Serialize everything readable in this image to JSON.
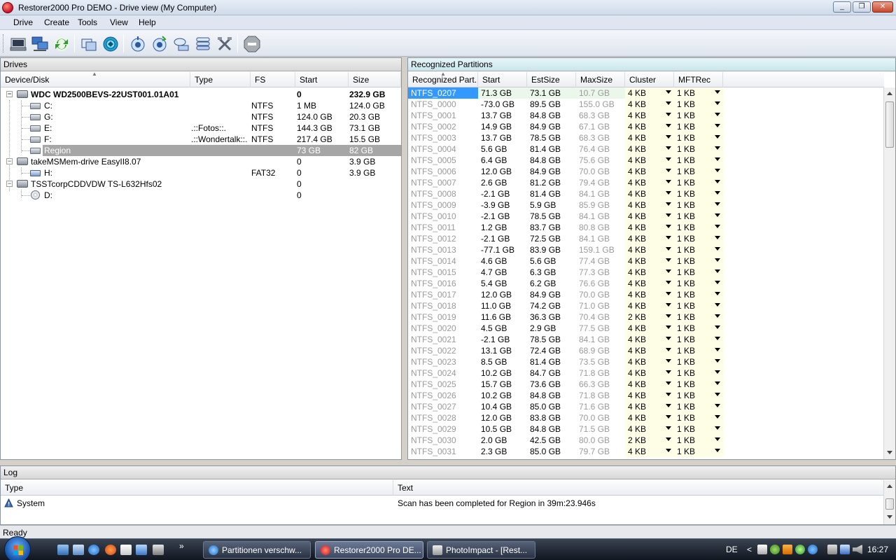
{
  "window": {
    "title": "Restorer2000 Pro DEMO - Drive view (My Computer)",
    "minimize_glyph": "_",
    "maximize_glyph": "❐",
    "close_glyph": "✕"
  },
  "menu": [
    "Drive",
    "Create",
    "Tools",
    "View",
    "Help"
  ],
  "toolbar": {
    "icons": [
      "drive-icon",
      "network-drive-icon",
      "refresh-icon",
      "copy-icon",
      "globe-icon",
      "scan-icon",
      "search-icon",
      "network-icon",
      "stack-icon",
      "tools-icon",
      "stop-icon"
    ]
  },
  "drives": {
    "panel_title": "Drives",
    "columns": [
      "Device/Disk",
      "Type",
      "FS",
      "Start",
      "Size"
    ],
    "rows": [
      {
        "name": "WDC WD2500BEVS-22UST001.01A01",
        "type": "",
        "fs": "",
        "start": "0",
        "size": "232.9 GB",
        "icon": "disk-icon"
      },
      {
        "name": "C:",
        "type": "",
        "fs": "NTFS",
        "start": "1 MB",
        "size": "124.0 GB",
        "icon": "drive-icon"
      },
      {
        "name": "G:",
        "type": "",
        "fs": "NTFS",
        "start": "124.0 GB",
        "size": "20.3 GB",
        "icon": "drive-icon"
      },
      {
        "name": "E:",
        "type": ".::Fotos::.",
        "fs": "NTFS",
        "start": "144.3 GB",
        "size": "73.1 GB",
        "icon": "drive-icon"
      },
      {
        "name": "F:",
        "type": ".::Wondertalk::.",
        "fs": "NTFS",
        "start": "217.4 GB",
        "size": "15.5 GB",
        "icon": "drive-icon"
      },
      {
        "name": "Region",
        "type": "",
        "fs": "",
        "start": "73 GB",
        "size": "82 GB",
        "icon": "drive-icon"
      },
      {
        "name": "takeMSMem-drive EasyII8.07",
        "type": "",
        "fs": "",
        "start": "0",
        "size": "3.9 GB",
        "icon": "disk-icon"
      },
      {
        "name": "H:",
        "type": "",
        "fs": "FAT32",
        "start": "0",
        "size": "3.9 GB",
        "icon": "usb-icon"
      },
      {
        "name": "TSSTcorpCDDVDW TS-L632Hfs02",
        "type": "",
        "fs": "",
        "start": "0",
        "size": "",
        "icon": "disk-icon"
      },
      {
        "name": "D:",
        "type": "",
        "fs": "",
        "start": "0",
        "size": "",
        "icon": "cd-icon"
      }
    ]
  },
  "partitions": {
    "panel_title": "Recognized Partitions",
    "columns": [
      "Recognized Part...",
      "Start",
      "EstSize",
      "MaxSize",
      "Cluster",
      "MFTRec"
    ],
    "rows": [
      [
        "NTFS_0207",
        "71.3 GB",
        "73.1 GB",
        "10.7 GB",
        "4 KB",
        "1 KB"
      ],
      [
        "NTFS_0000",
        "-73.0 GB",
        "89.5 GB",
        "155.0 GB",
        "4 KB",
        "1 KB"
      ],
      [
        "NTFS_0001",
        "13.7 GB",
        "84.8 GB",
        "68.3 GB",
        "4 KB",
        "1 KB"
      ],
      [
        "NTFS_0002",
        "14.9 GB",
        "84.9 GB",
        "67.1 GB",
        "4 KB",
        "1 KB"
      ],
      [
        "NTFS_0003",
        "13.7 GB",
        "78.5 GB",
        "68.3 GB",
        "4 KB",
        "1 KB"
      ],
      [
        "NTFS_0004",
        "5.6 GB",
        "81.4 GB",
        "76.4 GB",
        "4 KB",
        "1 KB"
      ],
      [
        "NTFS_0005",
        "6.4 GB",
        "84.8 GB",
        "75.6 GB",
        "4 KB",
        "1 KB"
      ],
      [
        "NTFS_0006",
        "12.0 GB",
        "84.9 GB",
        "70.0 GB",
        "4 KB",
        "1 KB"
      ],
      [
        "NTFS_0007",
        "2.6 GB",
        "81.2 GB",
        "79.4 GB",
        "4 KB",
        "1 KB"
      ],
      [
        "NTFS_0008",
        "-2.1 GB",
        "81.4 GB",
        "84.1 GB",
        "4 KB",
        "1 KB"
      ],
      [
        "NTFS_0009",
        "-3.9 GB",
        "5.9 GB",
        "85.9 GB",
        "4 KB",
        "1 KB"
      ],
      [
        "NTFS_0010",
        "-2.1 GB",
        "78.5 GB",
        "84.1 GB",
        "4 KB",
        "1 KB"
      ],
      [
        "NTFS_0011",
        "1.2 GB",
        "83.7 GB",
        "80.8 GB",
        "4 KB",
        "1 KB"
      ],
      [
        "NTFS_0012",
        "-2.1 GB",
        "72.5 GB",
        "84.1 GB",
        "4 KB",
        "1 KB"
      ],
      [
        "NTFS_0013",
        "-77.1 GB",
        "83.9 GB",
        "159.1 GB",
        "4 KB",
        "1 KB"
      ],
      [
        "NTFS_0014",
        "4.6 GB",
        "5.6 GB",
        "77.4 GB",
        "4 KB",
        "1 KB"
      ],
      [
        "NTFS_0015",
        "4.7 GB",
        "6.3 GB",
        "77.3 GB",
        "4 KB",
        "1 KB"
      ],
      [
        "NTFS_0016",
        "5.4 GB",
        "6.2 GB",
        "76.6 GB",
        "4 KB",
        "1 KB"
      ],
      [
        "NTFS_0017",
        "12.0 GB",
        "84.9 GB",
        "70.0 GB",
        "4 KB",
        "1 KB"
      ],
      [
        "NTFS_0018",
        "11.0 GB",
        "74.2 GB",
        "71.0 GB",
        "4 KB",
        "1 KB"
      ],
      [
        "NTFS_0019",
        "11.6 GB",
        "36.3 GB",
        "70.4 GB",
        "2 KB",
        "1 KB"
      ],
      [
        "NTFS_0020",
        "4.5 GB",
        "2.9 GB",
        "77.5 GB",
        "4 KB",
        "1 KB"
      ],
      [
        "NTFS_0021",
        "-2.1 GB",
        "78.5 GB",
        "84.1 GB",
        "4 KB",
        "1 KB"
      ],
      [
        "NTFS_0022",
        "13.1 GB",
        "72.4 GB",
        "68.9 GB",
        "4 KB",
        "1 KB"
      ],
      [
        "NTFS_0023",
        "8.5 GB",
        "81.4 GB",
        "73.5 GB",
        "4 KB",
        "1 KB"
      ],
      [
        "NTFS_0024",
        "10.2 GB",
        "84.7 GB",
        "71.8 GB",
        "4 KB",
        "1 KB"
      ],
      [
        "NTFS_0025",
        "15.7 GB",
        "73.6 GB",
        "66.3 GB",
        "4 KB",
        "1 KB"
      ],
      [
        "NTFS_0026",
        "10.2 GB",
        "84.8 GB",
        "71.8 GB",
        "4 KB",
        "1 KB"
      ],
      [
        "NTFS_0027",
        "10.4 GB",
        "85.0 GB",
        "71.6 GB",
        "4 KB",
        "1 KB"
      ],
      [
        "NTFS_0028",
        "12.0 GB",
        "83.8 GB",
        "70.0 GB",
        "4 KB",
        "1 KB"
      ],
      [
        "NTFS_0029",
        "10.5 GB",
        "84.8 GB",
        "71.5 GB",
        "4 KB",
        "1 KB"
      ],
      [
        "NTFS_0030",
        "2.0 GB",
        "42.5 GB",
        "80.0 GB",
        "2 KB",
        "1 KB"
      ],
      [
        "NTFS_0031",
        "2.3 GB",
        "85.0 GB",
        "79.7 GB",
        "4 KB",
        "1 KB"
      ]
    ]
  },
  "log": {
    "panel_title": "Log",
    "columns": [
      "Type",
      "Text"
    ],
    "rows": [
      {
        "type": "System",
        "text": "Scan has been completed for Region  in 39m:23.946s",
        "icon": "info-icon"
      }
    ]
  },
  "status": "Ready",
  "taskbar": {
    "quick_launch_more": "»",
    "buttons": [
      {
        "label": "Partitionen verschw...",
        "icon": "ie-icon",
        "color": "#3a86d9"
      },
      {
        "label": "Restorer2000 Pro DE...",
        "icon": "restorer-icon",
        "color": "#d6203a"
      },
      {
        "label": "PhotoImpact - [Rest...",
        "icon": "photoimpact-icon",
        "color": "#c44"
      }
    ],
    "language": "DE",
    "tray_arrow": "<",
    "clock": "16:27"
  },
  "colors": {
    "selection": "#3399ff",
    "tree_selection": "#a6a6a6",
    "accent_header": "#c8e6ec"
  }
}
